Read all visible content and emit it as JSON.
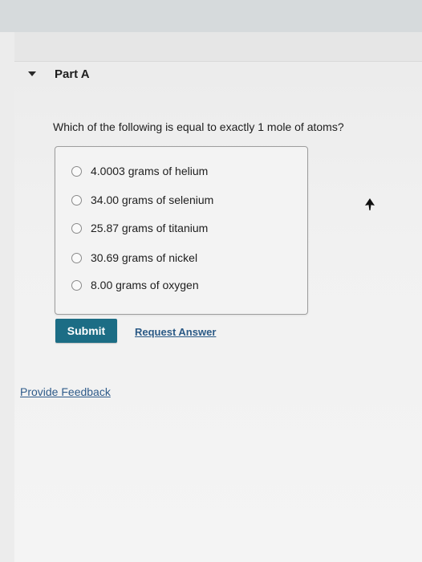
{
  "part": {
    "title": "Part A"
  },
  "question": {
    "text": "Which of the following is equal to exactly 1 mole of atoms?"
  },
  "options": [
    {
      "label": "4.0003 grams of helium",
      "selected": false
    },
    {
      "label": "34.00 grams of selenium",
      "selected": false
    },
    {
      "label": "25.87 grams of titanium",
      "selected": false
    },
    {
      "label": "30.69 grams of nickel",
      "selected": false
    },
    {
      "label": "8.00 grams of oxygen",
      "selected": false
    }
  ],
  "actions": {
    "submit_label": "Submit",
    "request_answer_label": "Request Answer"
  },
  "footer": {
    "feedback_label": "Provide Feedback"
  },
  "icons": {
    "collapse": "caret-down-icon",
    "radio": "radio-empty-icon",
    "pointer": "mouse-cursor-icon"
  },
  "colors": {
    "submit_background": "#1c6d85",
    "link": "#2b5a86"
  }
}
